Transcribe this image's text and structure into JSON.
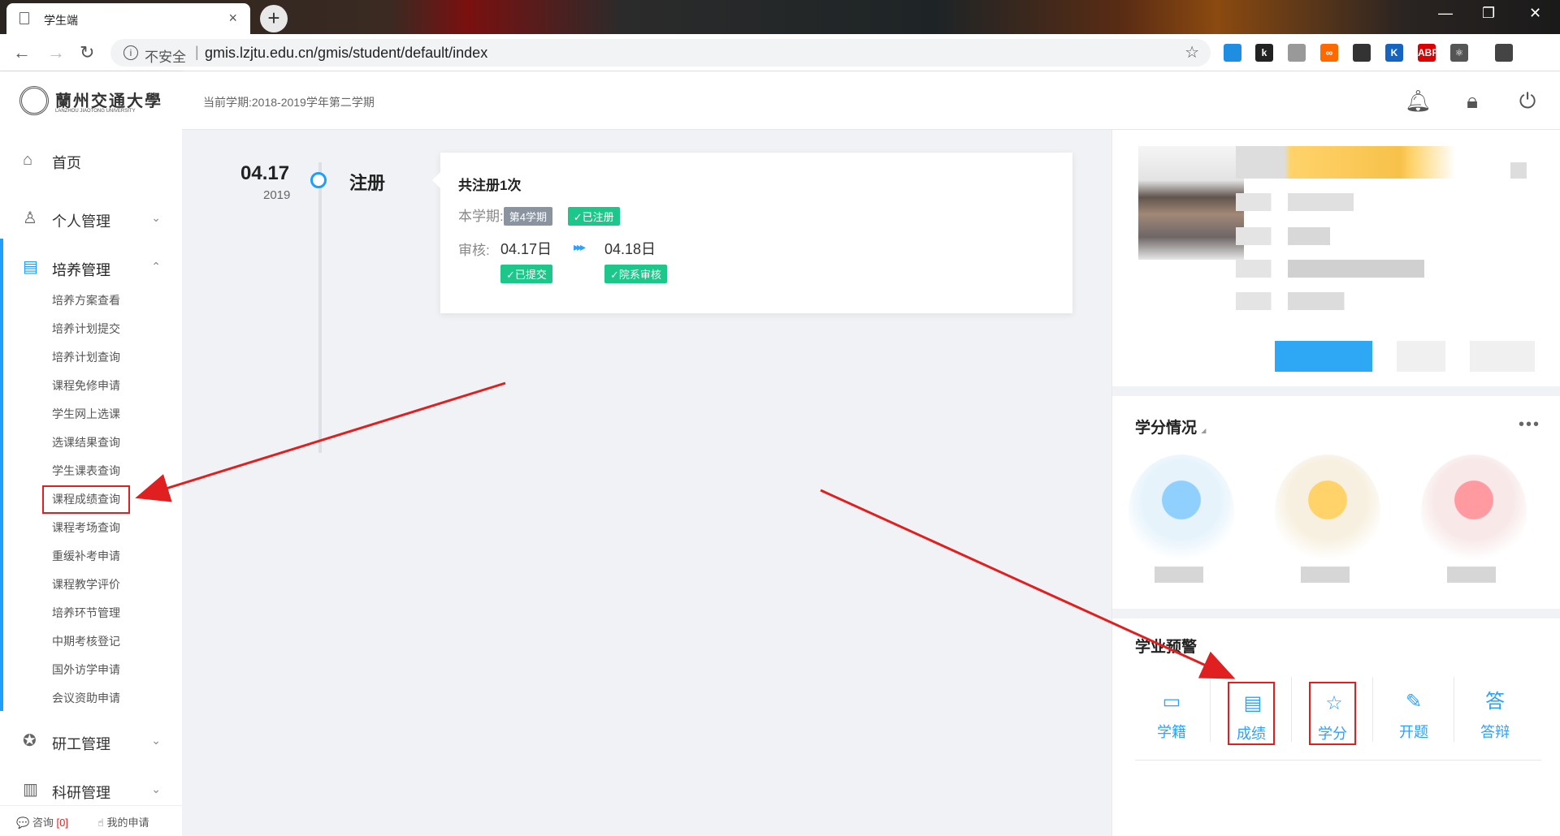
{
  "browser": {
    "tab_title": "学生端",
    "tab_close": "×",
    "newtab": "+",
    "insecure_label": "不安全",
    "separator": "|",
    "url": "gmis.lzjtu.edu.cn/gmis/student/default/index",
    "window_controls": [
      "—",
      "❐",
      "✕"
    ],
    "extensions": [
      {
        "name": "ext-blue",
        "text": "",
        "color": "#1e8fe0"
      },
      {
        "name": "ext-k-black",
        "text": "k",
        "color": "#222"
      },
      {
        "name": "ext-gray",
        "text": "",
        "color": "#999"
      },
      {
        "name": "ext-infinity",
        "text": "∞",
        "color": "#ff6a00"
      },
      {
        "name": "ext-dark",
        "text": "",
        "color": "#333"
      },
      {
        "name": "ext-k-blue",
        "text": "K",
        "color": "#1565c0"
      },
      {
        "name": "ext-abp",
        "text": "ABP",
        "color": "#d00"
      },
      {
        "name": "ext-react",
        "text": "⚛",
        "color": "#555"
      },
      {
        "name": "ext-profile",
        "text": "",
        "color": "#444"
      }
    ]
  },
  "sidebar": {
    "logo_cn": "蘭州交通大學",
    "logo_en": "LANZHOU JIAOTONG UNIVERSITY",
    "menu": [
      {
        "label": "首页",
        "icon": "home-icon",
        "glyph": "⌂",
        "chevron": ""
      },
      {
        "label": "个人管理",
        "icon": "user-icon",
        "glyph": "♙",
        "chevron": "⌄"
      },
      {
        "label": "培养管理",
        "icon": "document-icon",
        "glyph": "▤",
        "chevron": "⌃"
      },
      {
        "label": "研工管理",
        "icon": "award-icon",
        "glyph": "✪",
        "chevron": "⌄"
      },
      {
        "label": "科研管理",
        "icon": "chart-icon",
        "glyph": "▥",
        "chevron": "⌄"
      }
    ],
    "submenu": [
      "培养方案查看",
      "培养计划提交",
      "培养计划查询",
      "课程免修申请",
      "学生网上选课",
      "选课结果查询",
      "学生课表查询",
      "课程成绩查询",
      "课程考场查询",
      "重缓补考申请",
      "课程教学评价",
      "培养环节管理",
      "中期考核登记",
      "国外访学申请",
      "会议资助申请"
    ],
    "bottom": {
      "consult": "咨询",
      "consult_count": "[0]",
      "my_apply": "我的申请"
    }
  },
  "topbar": {
    "term": "当前学期:2018-2019学年第二学期"
  },
  "timeline": {
    "date": "04.17",
    "year": "2019",
    "event": "注册",
    "card": {
      "title": "共注册1次",
      "semester_label": "本学期:",
      "semester_tag": "第4学期",
      "registered_tag": "✓已注册",
      "review_label": "审核:",
      "date1": "04.17日",
      "date2": "04.18日",
      "arrow": "▸▸▸",
      "submitted_tag": "✓已提交",
      "dept_review_tag": "✓院系审核"
    }
  },
  "right": {
    "credit_title": "学分情况",
    "credit_caret": "◢",
    "more": "•••",
    "warning_title": "学业预警",
    "quicklinks": [
      {
        "label": "学籍",
        "icon": "id-card-icon",
        "glyph": "▭"
      },
      {
        "label": "成绩",
        "icon": "report-icon",
        "glyph": "▤"
      },
      {
        "label": "学分",
        "icon": "star-icon",
        "glyph": "☆"
      },
      {
        "label": "开题",
        "icon": "edit-icon",
        "glyph": "✎"
      },
      {
        "label": "答辩",
        "icon": "answer-icon",
        "glyph": "答"
      }
    ]
  },
  "colors": {
    "accent": "#1e9fff",
    "success": "#1dc68a",
    "annotation": "#e02020"
  }
}
